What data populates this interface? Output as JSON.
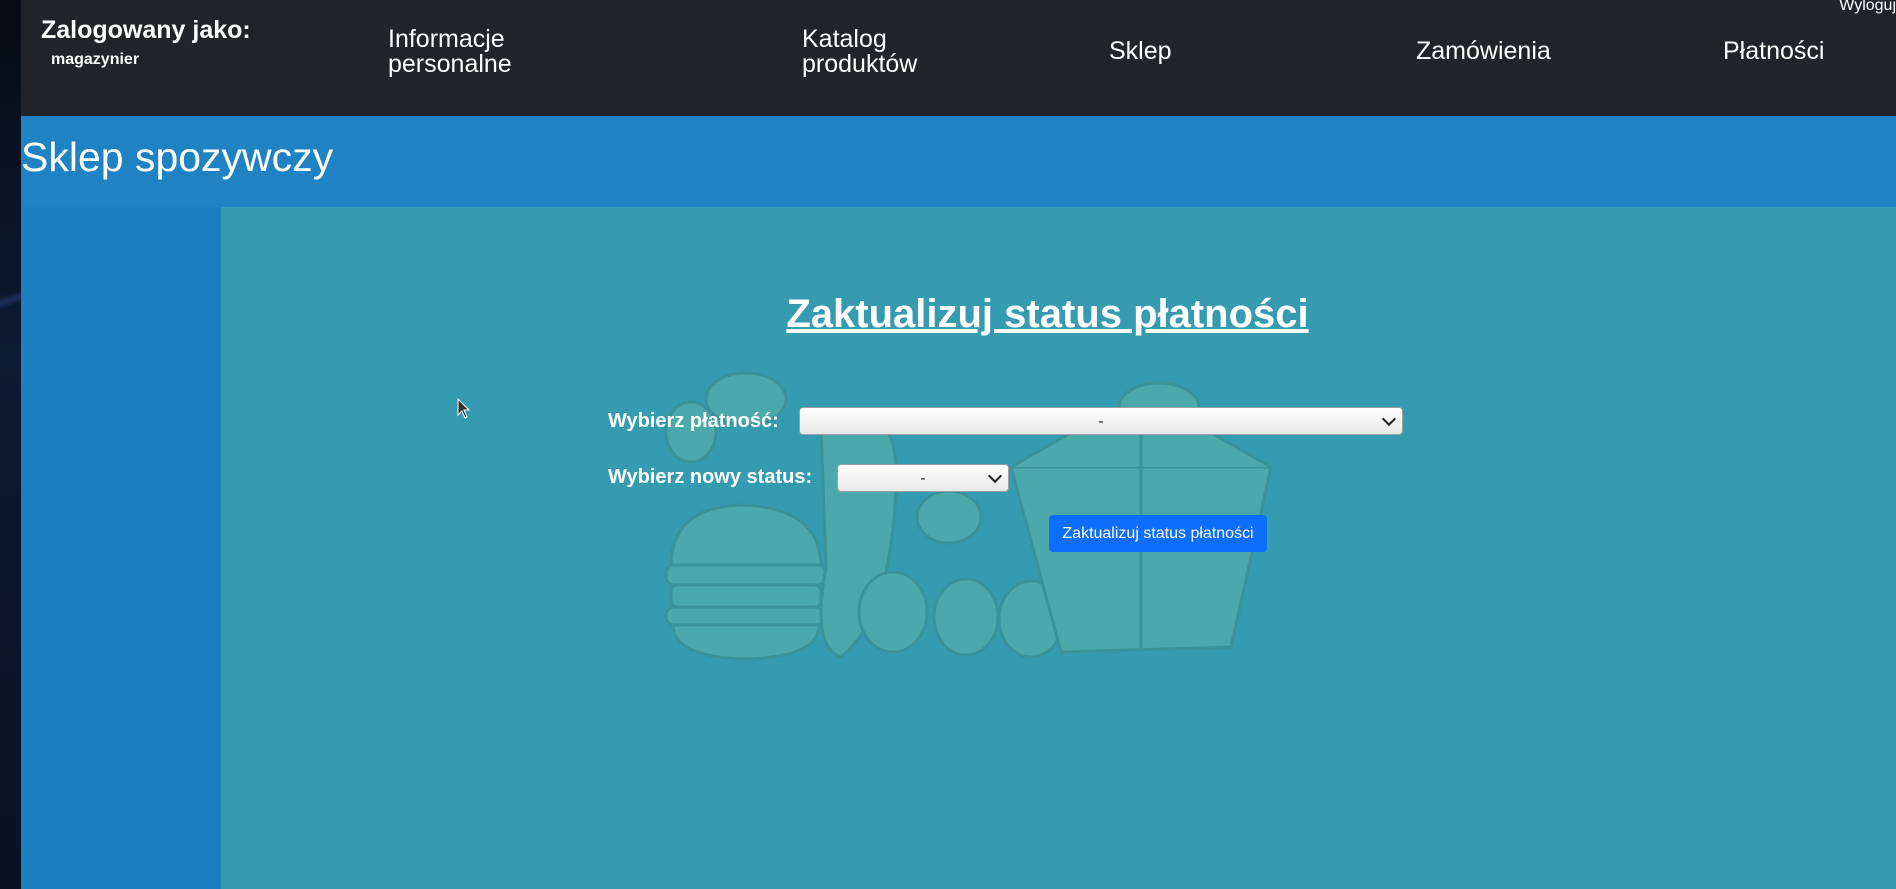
{
  "header": {
    "logged_in_label": "Zalogowany jako:",
    "username": "magazynier",
    "logout_label": "Wyloguj",
    "nav": [
      {
        "label": "Informacje\npersonalne"
      },
      {
        "label": "Katalog\nproduktów"
      },
      {
        "label": "Sklep"
      },
      {
        "label": "Zamówienia"
      },
      {
        "label": "Płatności"
      }
    ]
  },
  "site": {
    "title": "Sklep spozywczy"
  },
  "form": {
    "heading": "Zaktualizuj status płatności",
    "payment_label": "Wybierz płatność:",
    "payment_value": "-",
    "status_label": "Wybierz nowy status:",
    "status_value": "-",
    "submit_label": "Zaktualizuj status płatności"
  },
  "colors": {
    "topbar": "#212429",
    "title_band": "#1e82c3",
    "content": "#349bb0",
    "button": "#0d6efd"
  },
  "icons": [
    "chevron-down-icon",
    "mouse-cursor-icon"
  ]
}
